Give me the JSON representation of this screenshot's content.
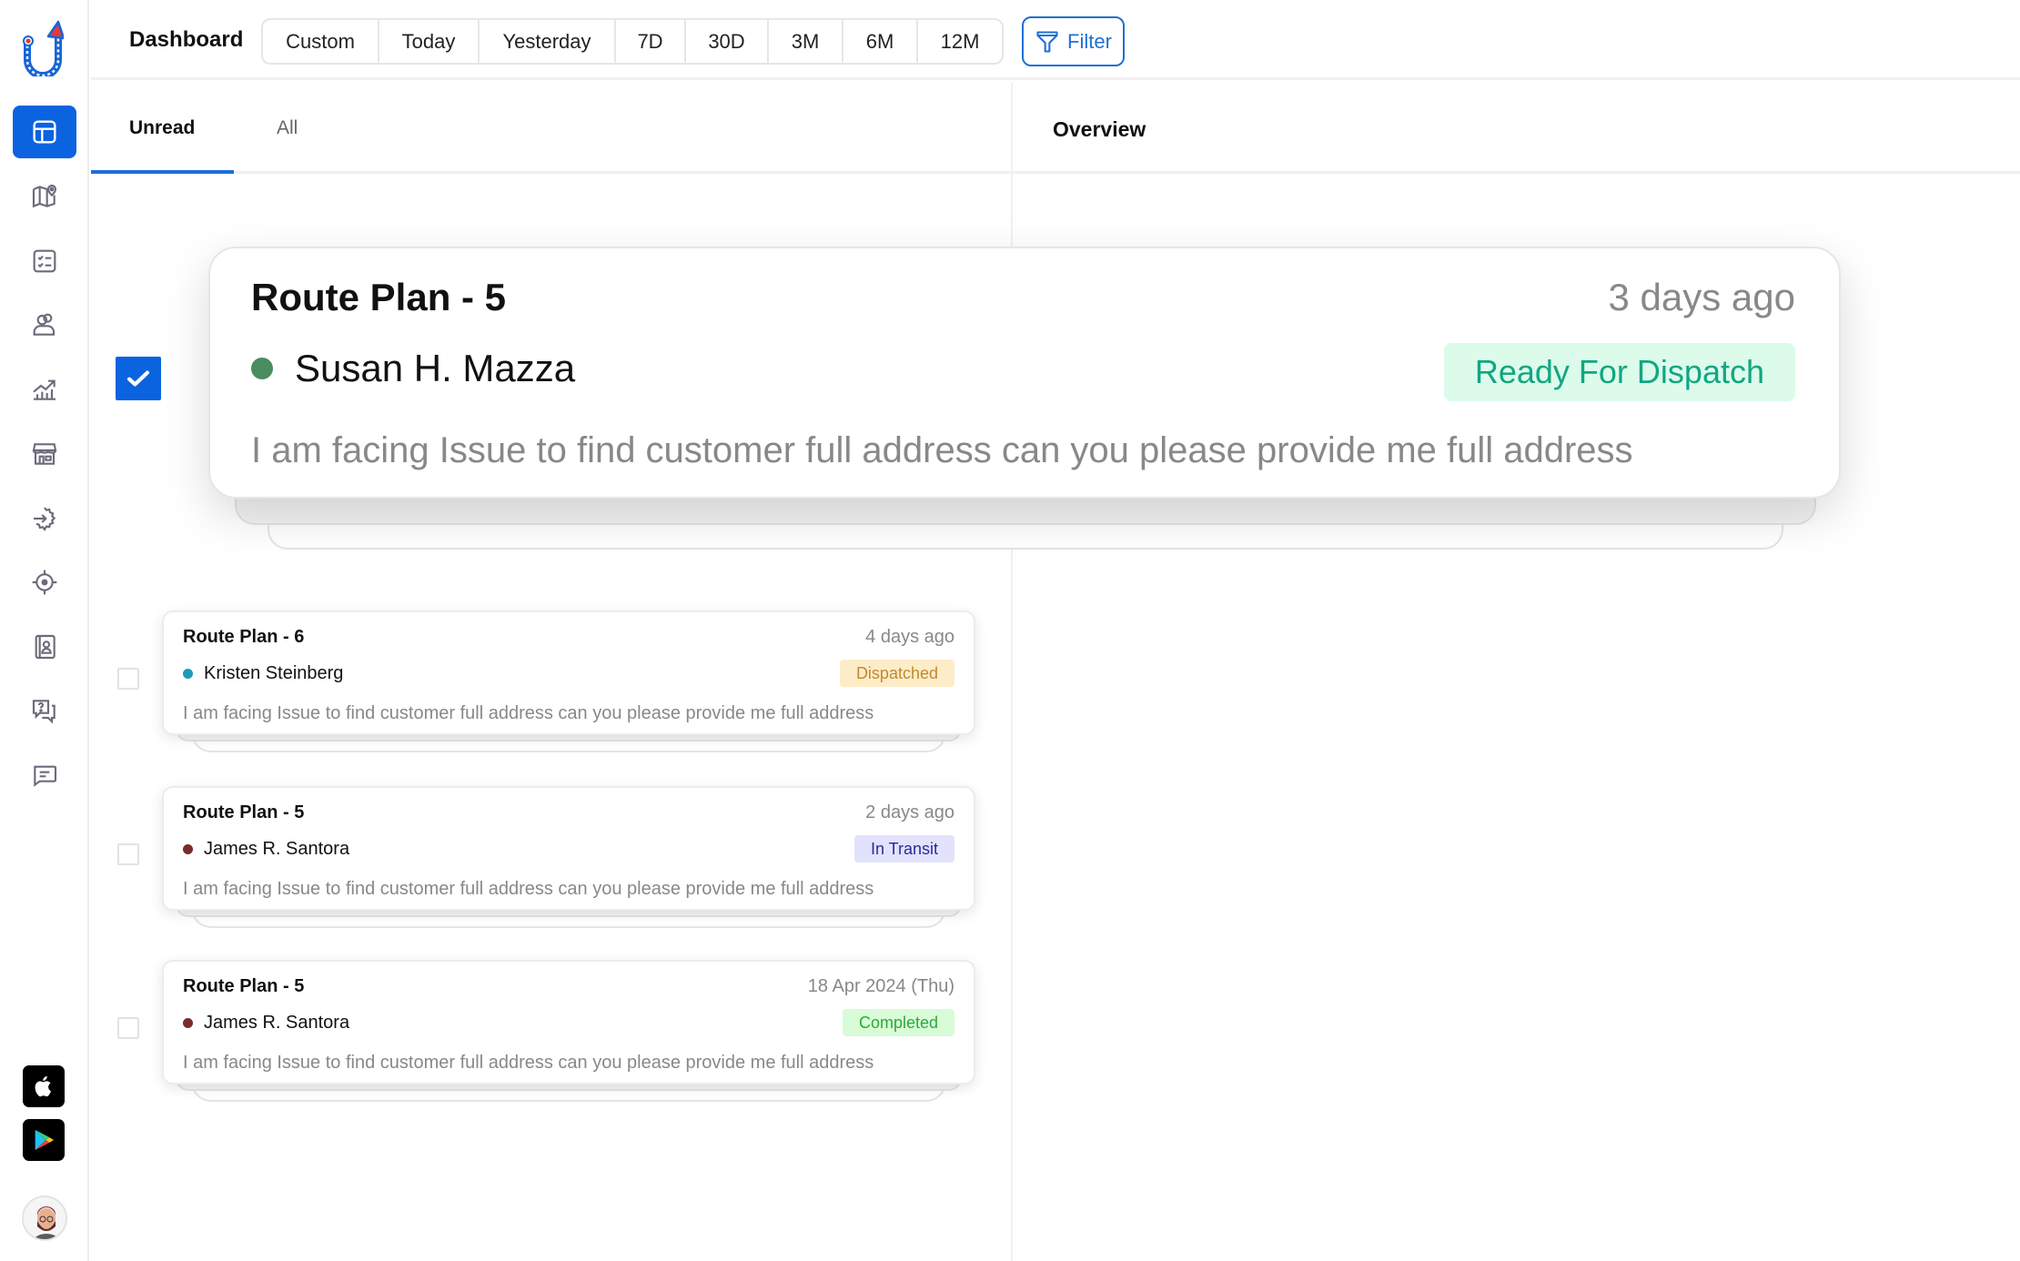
{
  "app": {
    "brand_colors": {
      "primary": "#0b63e0",
      "accent_red": "#e23b3b"
    }
  },
  "sidebar": {
    "logo": "route-logo",
    "items": [
      {
        "name": "dashboard",
        "icon": "layout-icon",
        "active": true
      },
      {
        "name": "map",
        "icon": "map-pin-icon",
        "active": false
      },
      {
        "name": "tasks",
        "icon": "checklist-icon",
        "active": false
      },
      {
        "name": "users",
        "icon": "users-icon",
        "active": false
      },
      {
        "name": "analytics",
        "icon": "chart-up-icon",
        "active": false
      },
      {
        "name": "store",
        "icon": "store-icon",
        "active": false
      },
      {
        "name": "integrations",
        "icon": "gear-arrow-icon",
        "active": false
      },
      {
        "name": "tracking",
        "icon": "target-icon",
        "active": false
      },
      {
        "name": "contacts",
        "icon": "contact-book-icon",
        "active": false
      },
      {
        "name": "support",
        "icon": "help-chat-icon",
        "active": false
      },
      {
        "name": "messages",
        "icon": "message-icon",
        "active": false
      }
    ],
    "apps": [
      {
        "name": "app-store",
        "icon": "apple-icon"
      },
      {
        "name": "play-store",
        "icon": "google-play-icon"
      }
    ]
  },
  "header": {
    "title": "Dashboard",
    "ranges": [
      "Custom",
      "Today",
      "Yesterday",
      "7D",
      "30D",
      "3M",
      "6M",
      "12M"
    ],
    "filter_label": "Filter"
  },
  "tabs": {
    "unread": "Unread",
    "all": "All",
    "active": "Unread"
  },
  "overview": {
    "title": "Overview"
  },
  "featured": {
    "checked": true,
    "title": "Route Plan - 5",
    "time": "3 days ago",
    "person": "Susan H. Mazza",
    "dot_color": "#4a8b5f",
    "status": "Ready For Dispatch",
    "status_bg": "#dcfbea",
    "status_fg": "#12a683",
    "message": "I am facing Issue to find customer full address can you please provide me full address"
  },
  "notifications": [
    {
      "checked": false,
      "title": "Route Plan - 6",
      "time": "4 days ago",
      "person": "Kristen Steinberg",
      "dot_color": "#1e9bb5",
      "status": "Dispatched",
      "status_bg": "#fdecc8",
      "status_fg": "#c08a2e",
      "message": "I am facing Issue to find customer full address can you please provide me full address"
    },
    {
      "checked": false,
      "title": "Route Plan - 5",
      "time": "2 days ago",
      "person": "James R. Santora",
      "dot_color": "#7a2b2b",
      "status": "In Transit",
      "status_bg": "#e3e2fd",
      "status_fg": "#2a2a9a",
      "message": "I am facing Issue to find customer full address can you please provide me full address"
    },
    {
      "checked": false,
      "title": "Route Plan - 5",
      "time": "18 Apr 2024 (Thu)",
      "person": "James R. Santora",
      "dot_color": "#7a2b2b",
      "status": "Completed",
      "status_bg": "#d8fbd8",
      "status_fg": "#2fa83a",
      "message": "I am facing Issue to find customer full address can you please provide me full address"
    }
  ]
}
